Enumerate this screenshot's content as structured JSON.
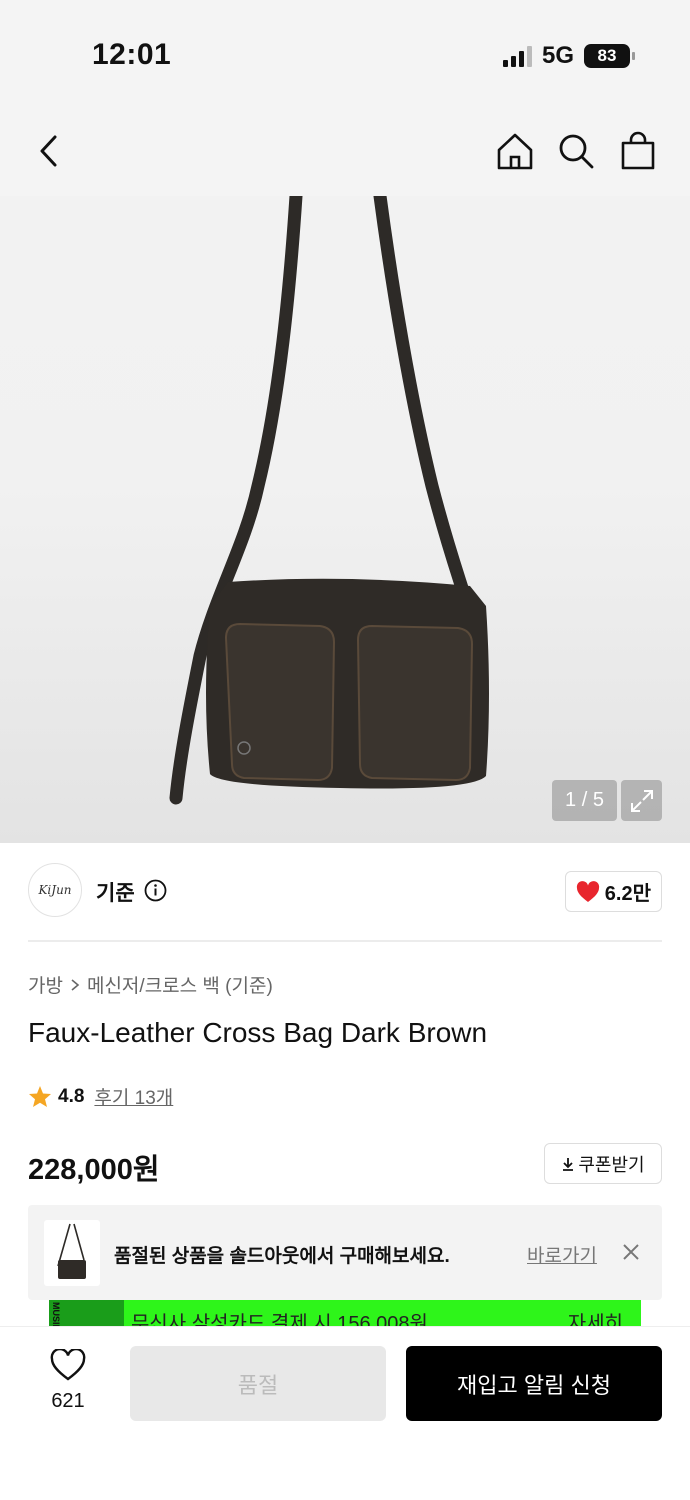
{
  "status_bar": {
    "time": "12:01",
    "network": "5G",
    "battery": "83"
  },
  "gallery": {
    "counter": "1 / 5"
  },
  "brand": {
    "logo_text": "KiJun",
    "name": "기준",
    "likes": "6.2만"
  },
  "breadcrumb": {
    "category": "가방",
    "subcategory": "메신저/크로스 백 (기준)"
  },
  "product": {
    "title": "Faux-Leather Cross Bag Dark Brown",
    "rating": "4.8",
    "review_link": "후기 13개",
    "price": "228,000원",
    "coupon_label": "쿠폰받기"
  },
  "soldout_banner": {
    "text": "품절된 상품을 솔드아웃에서 구매해보세요.",
    "link": "바로가기"
  },
  "promo": {
    "side_label": "MUSINSA",
    "text": "무신사 삼성카드 결제 시 156,008원",
    "detail": "자세히"
  },
  "bottom_bar": {
    "wish_count": "621",
    "soldout_label": "품절",
    "restock_label": "재입고 알림 신청"
  },
  "colors": {
    "accent_red": "#e8252d",
    "star": "#f5a623",
    "promo_green": "#2ef51a",
    "primary_button": "#000000"
  }
}
